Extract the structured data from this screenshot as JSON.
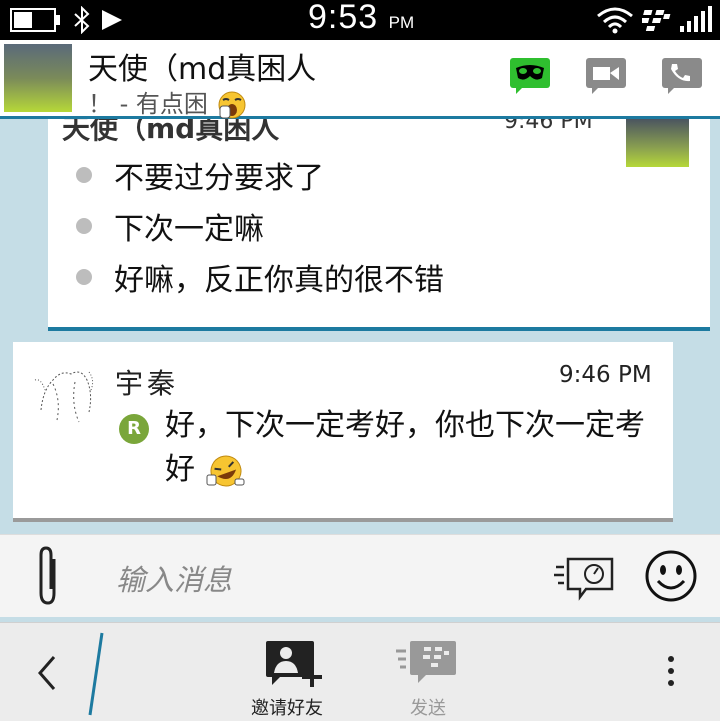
{
  "status_bar": {
    "time": "9:53",
    "ampm": "PM"
  },
  "header": {
    "title": "天使（md真困人",
    "subtitle": "！ - 有点困",
    "icons": [
      "video-mask-icon",
      "video-camera-icon",
      "phone-icon"
    ]
  },
  "chat": {
    "messages": [
      {
        "sender": "天使（md真困人",
        "time": "9:46 PM",
        "bullets": [
          "不要过分要求了",
          "下次一定嘛",
          "好嘛，反正你真的很不错"
        ]
      },
      {
        "sender": "宇秦",
        "time": "9:46 PM",
        "badge": "R",
        "text": "好，下次一定考好，你也下次一定考好"
      }
    ]
  },
  "input": {
    "placeholder": "输入消息"
  },
  "bottom_bar": {
    "invite_label": "邀请好友",
    "send_label": "发送"
  },
  "colors": {
    "accent": "#1d7aa0",
    "bbm_green": "#2fbf2f",
    "chat_bg": "#c5dde6",
    "badge": "#7aa63a"
  }
}
